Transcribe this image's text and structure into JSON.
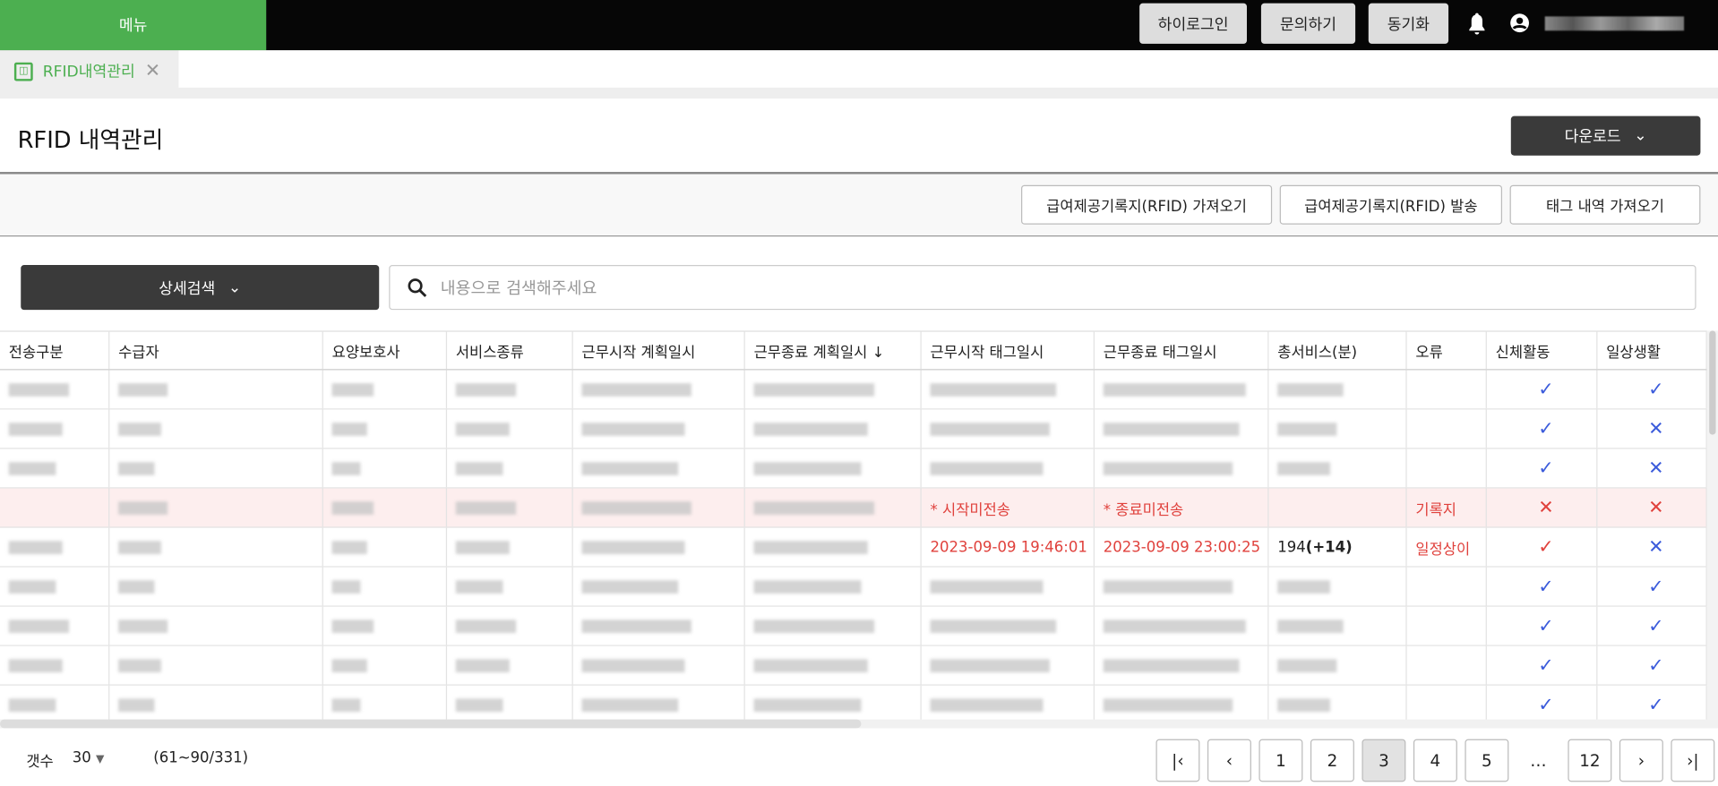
{
  "topbar": {
    "menu": "메뉴",
    "buttons": [
      "하이로그인",
      "문의하기",
      "동기화"
    ]
  },
  "tab": {
    "label": "RFID내역관리"
  },
  "page": {
    "title": "RFID 내역관리",
    "download": "다운로드"
  },
  "actions": [
    "급여제공기록지(RFID) 가져오기",
    "급여제공기록지(RFID) 발송",
    "태그 내역 가져오기"
  ],
  "search": {
    "detail": "상세검색",
    "placeholder": "내용으로 검색해주세요"
  },
  "table": {
    "headers": [
      "전송구분",
      "수급자",
      "요양보호사",
      "서비스종류",
      "근무시작 계획일시",
      "근무종료 계획일시 ↓",
      "근무시작 태그일시",
      "근무종료 태그일시",
      "총서비스(분)",
      "오류",
      "신체활동",
      "일상생활"
    ],
    "rows": [
      {
        "error": "",
        "body": "check",
        "daily": "check"
      },
      {
        "error": "",
        "body": "check",
        "daily": "cross"
      },
      {
        "error": "",
        "body": "check",
        "daily": "cross"
      },
      {
        "start_tag": "* 시작미전송",
        "end_tag": "* 종료미전송",
        "error": "기록지",
        "body": "cross",
        "daily": "cross"
      },
      {
        "start_tag": "2023-09-09 19:46:01",
        "end_tag": "2023-09-09 23:00:25",
        "total": "194",
        "total_extra": "(+14)",
        "error": "일정상이",
        "body": "check",
        "daily": "cross"
      },
      {
        "error": "",
        "body": "check",
        "daily": "check"
      },
      {
        "error": "",
        "body": "check",
        "daily": "check"
      },
      {
        "error": "",
        "body": "check",
        "daily": "check"
      },
      {
        "error": "",
        "body": "check",
        "daily": "check"
      }
    ]
  },
  "footer": {
    "count_label": "갯수",
    "count": "30",
    "range": "(61~90/331)",
    "pages": [
      "1",
      "2",
      "3",
      "4",
      "5",
      "…",
      "12"
    ],
    "current": "3"
  },
  "colors": {
    "green": "#4caf50",
    "red": "#e0413c",
    "blue": "#3b5bdb"
  }
}
